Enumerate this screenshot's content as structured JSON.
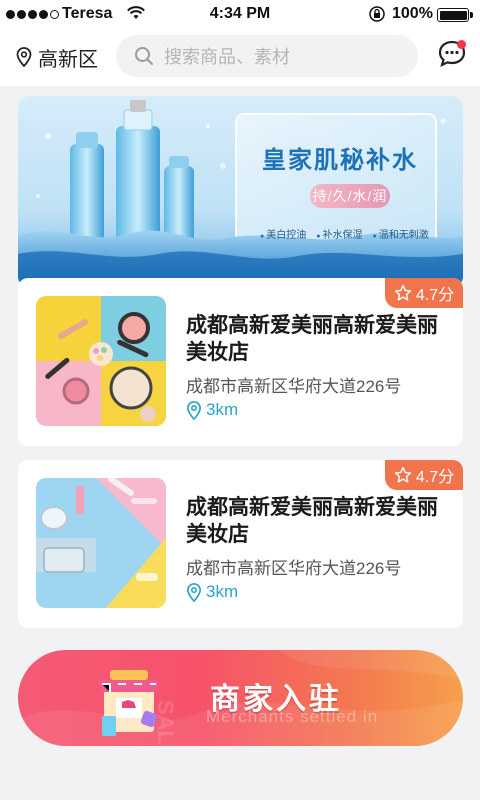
{
  "status_bar": {
    "carrier": "Teresa",
    "time": "4:34 PM",
    "battery": "100%",
    "battery_level": 1.0,
    "signal_bars": 4
  },
  "header": {
    "location": "高新区",
    "search_placeholder": "搜索商品、素材",
    "icons": {
      "location": "location-pin-icon",
      "search": "search-icon",
      "message": "message-icon"
    }
  },
  "banner": {
    "title": "皇家肌秘补水",
    "subtitle": "持/久/水/润",
    "tags": [
      "美白控油",
      "补水保湿",
      "温和无刺激"
    ]
  },
  "stores": [
    {
      "rating": "4.7分",
      "name": "成都高新爱美丽高新爱美丽美妆店",
      "address": "成都市高新区华府大道226号",
      "distance": "3km"
    },
    {
      "rating": "4.7分",
      "name": "成都高新爱美丽高新爱美丽美妆店",
      "address": "成都市高新区华府大道226号",
      "distance": "3km"
    }
  ],
  "merchants": {
    "title": "商家入驻",
    "subtitle": "Merchants settled in"
  },
  "colors": {
    "accent_orange": "#f2744c",
    "distance_blue": "#2aa3c9",
    "banner_blue": "#1d73b8"
  }
}
